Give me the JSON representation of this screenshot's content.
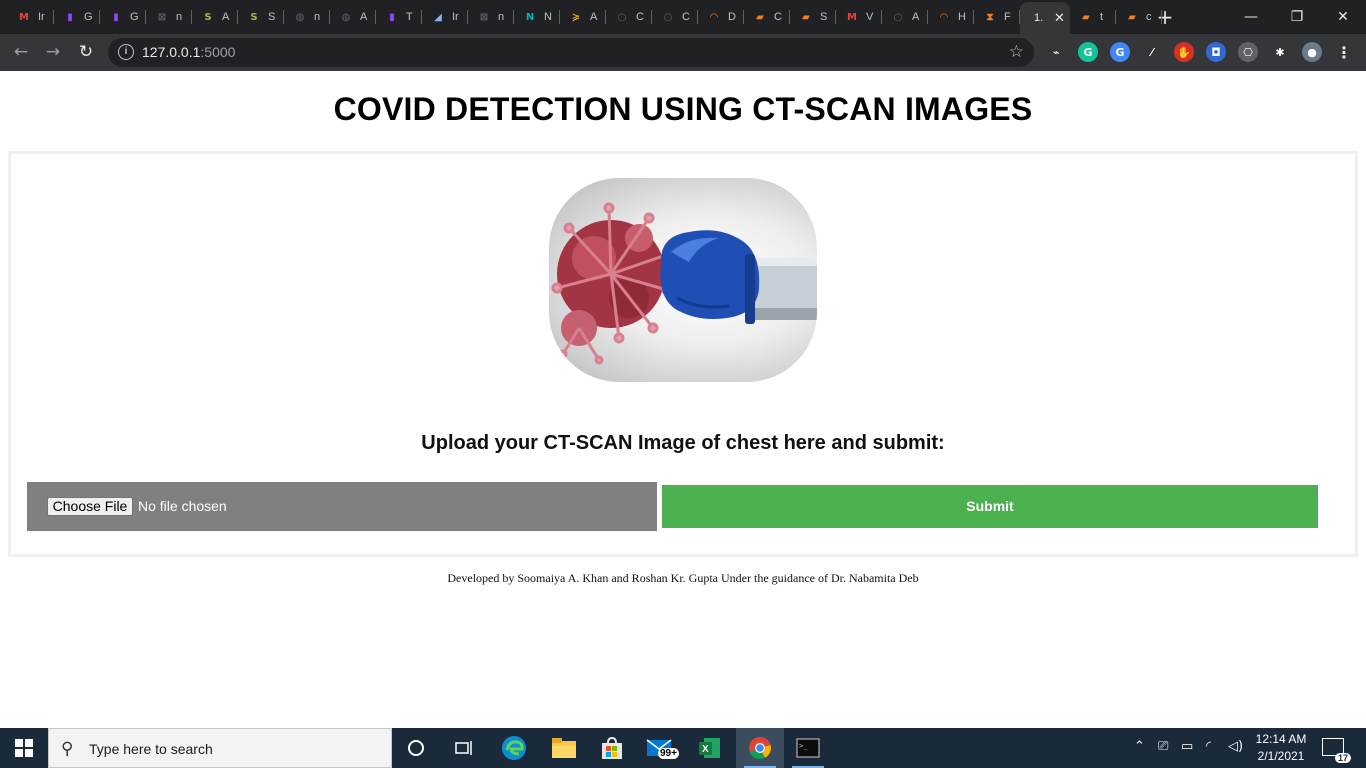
{
  "browser": {
    "tabs": [
      {
        "letter": "M",
        "title": "Ir",
        "color": "#ea4335",
        "icon": "gmail-icon"
      },
      {
        "letter": "▮",
        "title": "G",
        "color": "#9146ff",
        "icon": "twitch-icon"
      },
      {
        "letter": "▮",
        "title": "G",
        "color": "#9146ff",
        "icon": "twitch-icon"
      },
      {
        "letter": "⊠",
        "title": "n",
        "color": "#5f6368",
        "icon": "box-icon"
      },
      {
        "letter": "S",
        "title": "A",
        "color": "#95bf47",
        "icon": "shopify-icon"
      },
      {
        "letter": "S",
        "title": "S",
        "color": "#95bf47",
        "icon": "shopify-icon"
      },
      {
        "letter": "◍",
        "title": "n",
        "color": "#5f6368",
        "icon": "globe-icon"
      },
      {
        "letter": "◍",
        "title": "A",
        "color": "#5f6368",
        "icon": "globe-icon"
      },
      {
        "letter": "▮",
        "title": "T",
        "color": "#9146ff",
        "icon": "twitch-icon"
      },
      {
        "letter": "◢",
        "title": "Ir",
        "color": "#8ab4f8",
        "icon": "chart-icon"
      },
      {
        "letter": "⊠",
        "title": "n",
        "color": "#5f6368",
        "icon": "box-icon"
      },
      {
        "letter": "N",
        "title": "N",
        "color": "#00b4c8",
        "icon": "n-brand-icon"
      },
      {
        "letter": "≽",
        "title": "A",
        "color": "#e8a317",
        "icon": "stack-icon"
      },
      {
        "letter": "○",
        "title": "C",
        "color": "#5f6368",
        "icon": "github-icon"
      },
      {
        "letter": "○",
        "title": "C",
        "color": "#5f6368",
        "icon": "github-icon"
      },
      {
        "letter": "◠",
        "title": "D",
        "color": "#f48024",
        "icon": "arc-icon"
      },
      {
        "letter": "▰",
        "title": "C",
        "color": "#f48024",
        "icon": "book-icon"
      },
      {
        "letter": "▰",
        "title": "S",
        "color": "#f48024",
        "icon": "book-icon"
      },
      {
        "letter": "M",
        "title": "V",
        "color": "#ea4335",
        "icon": "gmail-icon"
      },
      {
        "letter": "○",
        "title": "A",
        "color": "#5f6368",
        "icon": "github-icon"
      },
      {
        "letter": "◠",
        "title": "H",
        "color": "#f48024",
        "icon": "arc-icon"
      },
      {
        "letter": "⧗",
        "title": "F",
        "color": "#f48024",
        "icon": "hourglass-icon"
      }
    ],
    "active_tab_title": "1.",
    "after_tabs": [
      {
        "letter": "▰",
        "title": "t",
        "color": "#f48024",
        "icon": "book-icon"
      },
      {
        "letter": "▰",
        "title": "c",
        "color": "#f48024",
        "icon": "book-icon"
      }
    ],
    "url_host": "127.0.0.1",
    "url_port": ":5000",
    "new_tab_symbol": "+",
    "extensions": [
      {
        "letter": "⌁",
        "color": "#35363a",
        "icon": "extension-mask-icon"
      },
      {
        "letter": "G",
        "color": "#15c39a",
        "icon": "grammarly-icon"
      },
      {
        "letter": "G",
        "color": "#4285f4",
        "icon": "translate-icon"
      },
      {
        "letter": "⁄",
        "color": "#35363a",
        "icon": "pen-icon"
      },
      {
        "letter": "✋",
        "color": "#d93025",
        "icon": "adblock-icon"
      },
      {
        "letter": "◘",
        "color": "#3367d6",
        "icon": "screen-icon"
      },
      {
        "letter": "⎔",
        "color": "#5f6368",
        "icon": "hex-icon"
      },
      {
        "letter": "✱",
        "color": "#35363a",
        "icon": "puzzle-icon"
      }
    ]
  },
  "page": {
    "title": "COVID DETECTION USING CT-SCAN IMAGES",
    "upload_label": "Upload your CT-SCAN Image of chest here and submit:",
    "choose_file_label": "Choose File",
    "file_status": "No file chosen",
    "submit_label": "Submit",
    "footer": "Developed by Soomaiya A. Khan and Roshan Kr. Gupta Under the guidance of Dr. Nabamita Deb"
  },
  "taskbar": {
    "search_placeholder": "Type here to search",
    "mail_badge": "99+",
    "time": "12:14 AM",
    "date": "2/1/2021",
    "notification_count": "17"
  }
}
